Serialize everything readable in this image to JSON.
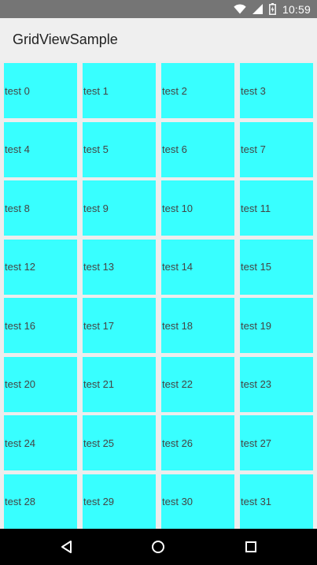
{
  "status_bar": {
    "time": "10:59",
    "icons": [
      "wifi-icon",
      "signal-icon",
      "battery-icon"
    ]
  },
  "app_bar": {
    "title": "GridViewSample"
  },
  "grid": {
    "columns": 4,
    "cell_color": "#38ffff",
    "items": [
      "test 0",
      "test 1",
      "test 2",
      "test 3",
      "test 4",
      "test 5",
      "test 6",
      "test 7",
      "test 8",
      "test 9",
      "test 10",
      "test 11",
      "test 12",
      "test 13",
      "test 14",
      "test 15",
      "test 16",
      "test 17",
      "test 18",
      "test 19",
      "test 20",
      "test 21",
      "test 22",
      "test 23",
      "test 24",
      "test 25",
      "test 26",
      "test 27",
      "test 28",
      "test 29",
      "test 30",
      "test 31"
    ]
  },
  "nav_bar": {
    "buttons": [
      "back-icon",
      "home-icon",
      "recents-icon"
    ]
  }
}
